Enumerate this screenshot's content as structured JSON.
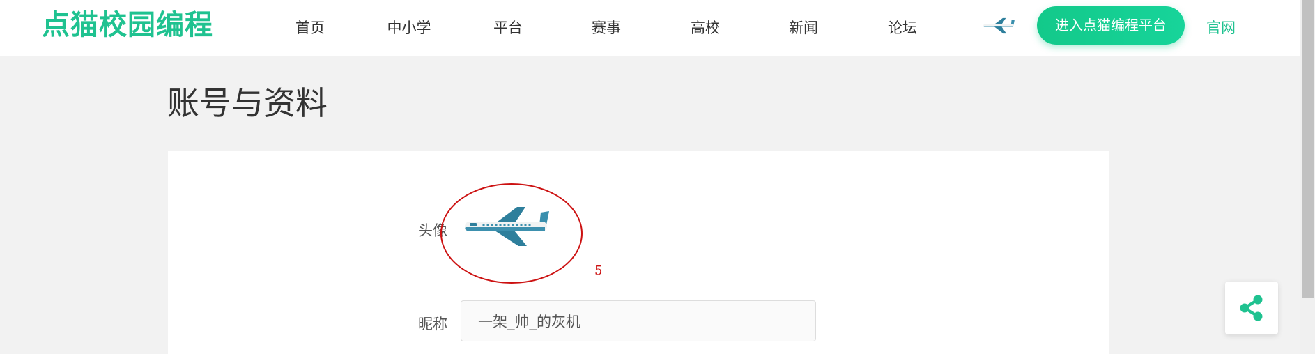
{
  "header": {
    "logo_text": "点猫校园编程",
    "nav": [
      {
        "label": "首页"
      },
      {
        "label": "中小学"
      },
      {
        "label": "平台"
      },
      {
        "label": "赛事"
      },
      {
        "label": "高校"
      },
      {
        "label": "新闻"
      },
      {
        "label": "论坛"
      }
    ],
    "enter_button": "进入点猫编程平台",
    "official_link": "官网"
  },
  "page": {
    "title": "账号与资料"
  },
  "form": {
    "avatar_label": "头像",
    "avatar_icon": "airplane-icon",
    "nickname_label": "昵称",
    "nickname_value": "一架_帅_的灰机"
  },
  "annotation": {
    "number": "5",
    "color": "#cc1111"
  },
  "share_icon": "share-icon",
  "colors": {
    "accent": "#1fc290",
    "background": "#f2f2f2"
  }
}
